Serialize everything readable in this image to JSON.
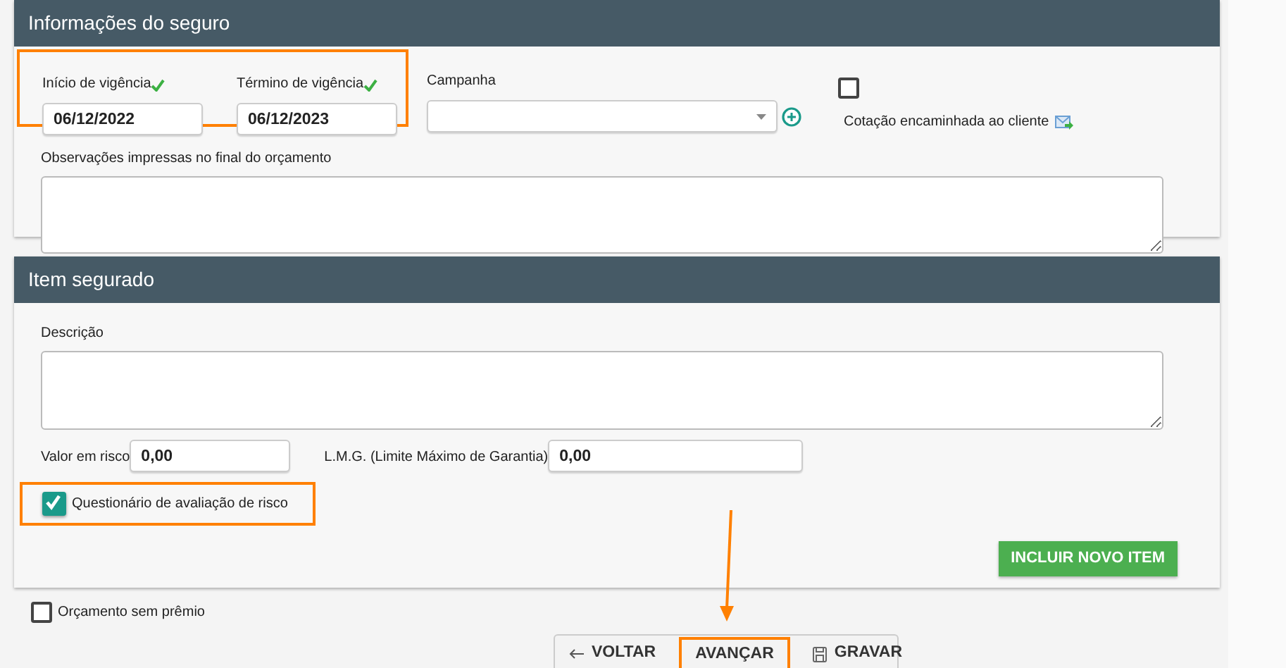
{
  "insurance_info": {
    "title": "Informações do seguro",
    "start_date": {
      "label": "Início de vigência",
      "value": "06/12/2022",
      "valid": true
    },
    "end_date": {
      "label": "Término de vigência",
      "value": "06/12/2023",
      "valid": true
    },
    "campaign": {
      "label": "Campanha"
    },
    "forwarded_to_client": {
      "label": "Cotação encaminhada ao cliente",
      "checked": false
    },
    "notes": {
      "label": "Observações impressas no final do orçamento"
    }
  },
  "insured_item": {
    "title": "Item segurado",
    "description": {
      "label": "Descrição"
    },
    "value_at_risk": {
      "label": "Valor em risco",
      "value": "0,00"
    },
    "lmg": {
      "label": "L.M.G. (Limite Máximo de Garantia)",
      "value": "0,00"
    },
    "risk_questionnaire": {
      "label": "Questionário de avaliação de risco",
      "checked": true
    },
    "add_button": "INCLUIR NOVO ITEM"
  },
  "no_premium": {
    "label": "Orçamento sem prêmio",
    "checked": false
  },
  "footer_buttons": [
    {
      "label": "VOLTAR",
      "kind": "back"
    },
    {
      "label": "AVANÇAR",
      "kind": "next"
    },
    {
      "label": "GRAVAR",
      "kind": "save"
    }
  ]
}
